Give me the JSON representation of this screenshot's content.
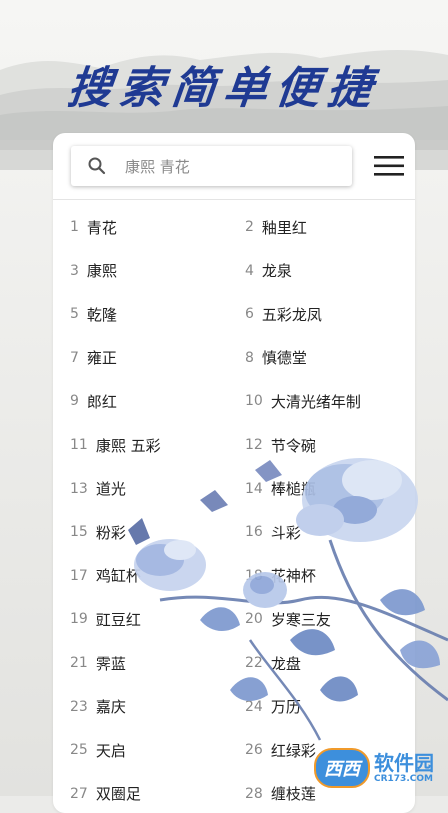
{
  "headline": "搜索简单便捷",
  "search": {
    "placeholder": "康熙 青花"
  },
  "list": [
    {
      "num": "1",
      "label": "青花"
    },
    {
      "num": "2",
      "label": "釉里红"
    },
    {
      "num": "3",
      "label": "康熙"
    },
    {
      "num": "4",
      "label": "龙泉"
    },
    {
      "num": "5",
      "label": "乾隆"
    },
    {
      "num": "6",
      "label": "五彩龙凤"
    },
    {
      "num": "7",
      "label": "雍正"
    },
    {
      "num": "8",
      "label": "慎德堂"
    },
    {
      "num": "9",
      "label": "郎红"
    },
    {
      "num": "10",
      "label": "大清光绪年制"
    },
    {
      "num": "11",
      "label": "康熙 五彩"
    },
    {
      "num": "12",
      "label": "节令碗"
    },
    {
      "num": "13",
      "label": "道光"
    },
    {
      "num": "14",
      "label": "棒槌瓶"
    },
    {
      "num": "15",
      "label": "粉彩"
    },
    {
      "num": "16",
      "label": "斗彩"
    },
    {
      "num": "17",
      "label": "鸡缸杯"
    },
    {
      "num": "18",
      "label": "花神杯"
    },
    {
      "num": "19",
      "label": "豇豆红"
    },
    {
      "num": "20",
      "label": "岁寒三友"
    },
    {
      "num": "21",
      "label": "霁蓝"
    },
    {
      "num": "22",
      "label": "龙盘"
    },
    {
      "num": "23",
      "label": "嘉庆"
    },
    {
      "num": "24",
      "label": "万历"
    },
    {
      "num": "25",
      "label": "天启"
    },
    {
      "num": "26",
      "label": "红绿彩"
    },
    {
      "num": "27",
      "label": "双圈足"
    },
    {
      "num": "28",
      "label": "缠枝莲"
    }
  ],
  "watermark": {
    "logo": "西西",
    "main": "软件园",
    "sub": "CR173.COM"
  },
  "colors": {
    "headline": "#1f3a93",
    "flower": "#7d99cf"
  }
}
